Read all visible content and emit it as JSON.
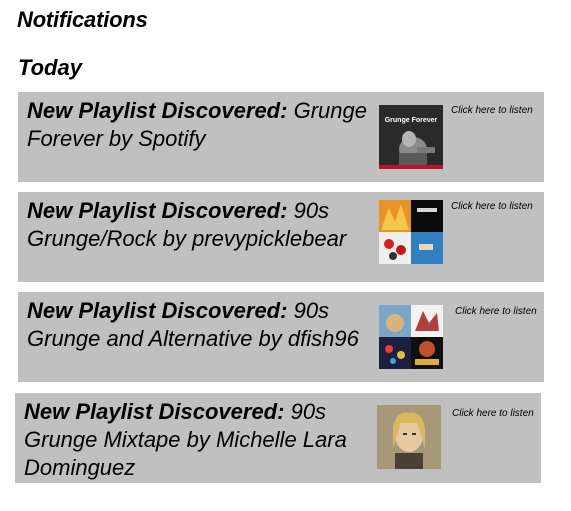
{
  "page": {
    "title": "Notifications",
    "section": "Today"
  },
  "notifications": [
    {
      "prefix": "New Playlist Discovered:",
      "playlist": "Grunge Forever by Spotify",
      "cover_text": "Grunge Forever",
      "link": "Click here to listen"
    },
    {
      "prefix": "New Playlist Discovered:",
      "playlist": "90s Grunge/Rock by prevypicklebear",
      "cover_text": "",
      "link": "Click here to listen"
    },
    {
      "prefix": "New Playlist Discovered:",
      "playlist": "90s Grunge and Alternative by dfish96",
      "cover_text": "",
      "link": "Click here to listen"
    },
    {
      "prefix": "New Playlist Discovered:",
      "playlist": "90s Grunge Mixtape by Michelle Lara Dominguez",
      "cover_text": "",
      "link": "Click here to listen"
    }
  ],
  "colors": {
    "card_background": "#c0c0c0",
    "page_background": "#ffffff"
  }
}
